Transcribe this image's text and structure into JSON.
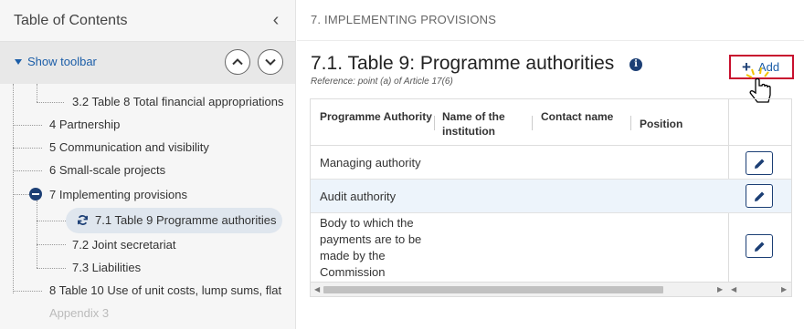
{
  "sidebar": {
    "title": "Table of Contents",
    "show_toolbar": "Show toolbar",
    "items": [
      {
        "label": "3.2 Table 8 Total financial appropriations"
      },
      {
        "label": "4 Partnership"
      },
      {
        "label": "5 Communication and visibility"
      },
      {
        "label": "6 Small-scale projects"
      },
      {
        "label": "7 Implementing provisions"
      },
      {
        "label": "7.1 Table 9 Programme authorities"
      },
      {
        "label": "7.2 Joint secretariat"
      },
      {
        "label": "7.3 Liabilities"
      },
      {
        "label": "8 Table 10 Use of unit costs, lump sums, flat"
      },
      {
        "label": "Appendix 3"
      }
    ]
  },
  "main": {
    "breadcrumb": "7. IMPLEMENTING PROVISIONS",
    "title": "7.1. Table 9: Programme authorities",
    "reference": "Reference: point (a) of Article 17(6)",
    "add_label": "Add",
    "table": {
      "headers": [
        "Programme Authority",
        "Name of the institution",
        "Contact name",
        "Position"
      ],
      "rows": [
        {
          "authority": "Managing authority"
        },
        {
          "authority": "Audit authority"
        },
        {
          "authority": "Body to which the payments are to be made by the Commission"
        }
      ]
    }
  },
  "colors": {
    "accent": "#1c3f75",
    "link": "#1c5ea8",
    "highlight": "#c8102e"
  }
}
